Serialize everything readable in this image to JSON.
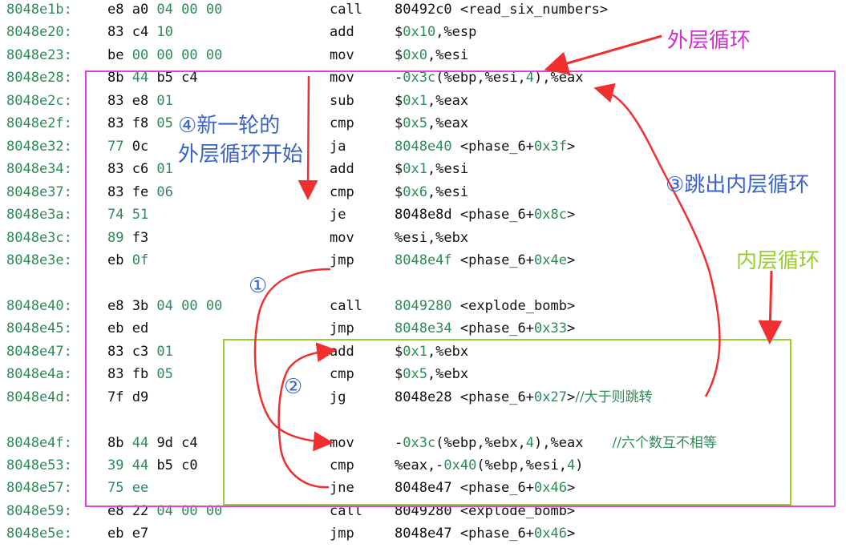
{
  "colors": {
    "addr": "#2e8b57",
    "text": "#111111",
    "numeric": "#2e8b57",
    "outer_box": "#e040e0",
    "inner_box": "#9acd32",
    "arrow": "#f03030",
    "annot_blue": "#3a63c8",
    "annot_magenta": "#d030d0",
    "annot_green": "#9acd32"
  },
  "rows": [
    {
      "addr": "8048e1b:",
      "bytes": [
        [
          "e8 a0 ",
          "h"
        ],
        [
          "04 00 00",
          "n"
        ]
      ],
      "mnem": "call",
      "ops": [
        [
          "80492c0 <read_six_numbers>",
          "t"
        ]
      ]
    },
    {
      "addr": "8048e20:",
      "bytes": [
        [
          "83 c4 ",
          "h"
        ],
        [
          "10",
          "n"
        ]
      ],
      "mnem": "add",
      "ops": [
        [
          "$",
          "t"
        ],
        [
          "0x10",
          "n"
        ],
        [
          ",%esp",
          "t"
        ]
      ]
    },
    {
      "addr": "8048e23:",
      "bytes": [
        [
          "be ",
          "h"
        ],
        [
          "00 00 00 00",
          "n"
        ]
      ],
      "mnem": "mov",
      "ops": [
        [
          "$",
          "t"
        ],
        [
          "0x0",
          "n"
        ],
        [
          ",%esi",
          "t"
        ]
      ]
    },
    {
      "addr": "8048e28:",
      "bytes": [
        [
          "8b ",
          "h"
        ],
        [
          "44 ",
          "n"
        ],
        [
          "b5 c4",
          "h"
        ]
      ],
      "mnem": "mov",
      "ops": [
        [
          "-",
          "t"
        ],
        [
          "0x3c",
          "n"
        ],
        [
          "(%ebp,%esi,",
          "t"
        ],
        [
          "4",
          "n"
        ],
        [
          "),%eax",
          "t"
        ]
      ]
    },
    {
      "addr": "8048e2c:",
      "bytes": [
        [
          "83 e8 ",
          "h"
        ],
        [
          "01",
          "n"
        ]
      ],
      "mnem": "sub",
      "ops": [
        [
          "$",
          "t"
        ],
        [
          "0x1",
          "n"
        ],
        [
          ",%eax",
          "t"
        ]
      ]
    },
    {
      "addr": "8048e2f:",
      "bytes": [
        [
          "83 f8 ",
          "h"
        ],
        [
          "05",
          "n"
        ]
      ],
      "mnem": "cmp",
      "ops": [
        [
          "$",
          "t"
        ],
        [
          "0x5",
          "n"
        ],
        [
          ",%eax",
          "t"
        ]
      ]
    },
    {
      "addr": "8048e32:",
      "bytes": [
        [
          "77 ",
          "n"
        ],
        [
          "0c",
          "h"
        ]
      ],
      "mnem": "ja",
      "ops": [
        [
          "8048e40",
          "n"
        ],
        [
          " <phase_6+",
          "t"
        ],
        [
          "0x3f",
          "n"
        ],
        [
          ">",
          "t"
        ]
      ]
    },
    {
      "addr": "8048e34:",
      "bytes": [
        [
          "83 c6 ",
          "h"
        ],
        [
          "01",
          "n"
        ]
      ],
      "mnem": "add",
      "ops": [
        [
          "$",
          "t"
        ],
        [
          "0x1",
          "n"
        ],
        [
          ",%esi",
          "t"
        ]
      ]
    },
    {
      "addr": "8048e37:",
      "bytes": [
        [
          "83 fe ",
          "h"
        ],
        [
          "06",
          "n"
        ]
      ],
      "mnem": "cmp",
      "ops": [
        [
          "$",
          "t"
        ],
        [
          "0x6",
          "n"
        ],
        [
          ",%esi",
          "t"
        ]
      ]
    },
    {
      "addr": "8048e3a:",
      "bytes": [
        [
          "74 51",
          "n"
        ]
      ],
      "mnem": "je",
      "ops": [
        [
          "8048e8d <phase_6+",
          "t"
        ],
        [
          "0x8c",
          "n"
        ],
        [
          ">",
          "t"
        ]
      ]
    },
    {
      "addr": "8048e3c:",
      "bytes": [
        [
          "89 ",
          "n"
        ],
        [
          "f3",
          "h"
        ]
      ],
      "mnem": "mov",
      "ops": [
        [
          "%esi,%ebx",
          "t"
        ]
      ]
    },
    {
      "addr": "8048e3e:",
      "bytes": [
        [
          "eb ",
          "h"
        ],
        [
          "0f",
          "n"
        ]
      ],
      "mnem": "jmp",
      "ops": [
        [
          "8048e4f",
          "n"
        ],
        [
          " <phase_6+",
          "t"
        ],
        [
          "0x4e",
          "n"
        ],
        [
          ">",
          "t"
        ]
      ]
    },
    null,
    {
      "addr": "8048e40:",
      "bytes": [
        [
          "e8 3b ",
          "h"
        ],
        [
          "04 00 00",
          "n"
        ]
      ],
      "mnem": "call",
      "ops": [
        [
          "8049280",
          "n"
        ],
        [
          " <explode_bomb>",
          "t"
        ]
      ]
    },
    {
      "addr": "8048e45:",
      "bytes": [
        [
          "eb ed",
          "h"
        ]
      ],
      "mnem": "jmp",
      "ops": [
        [
          "8048e34",
          "n"
        ],
        [
          " <phase_6+",
          "t"
        ],
        [
          "0x33",
          "n"
        ],
        [
          ">",
          "t"
        ]
      ]
    },
    {
      "addr": "8048e47:",
      "bytes": [
        [
          "83 c3 ",
          "h"
        ],
        [
          "01",
          "n"
        ]
      ],
      "mnem": "add",
      "ops": [
        [
          "$",
          "t"
        ],
        [
          "0x1",
          "n"
        ],
        [
          ",%ebx",
          "t"
        ]
      ]
    },
    {
      "addr": "8048e4a:",
      "bytes": [
        [
          "83 fb ",
          "h"
        ],
        [
          "05",
          "n"
        ]
      ],
      "mnem": "cmp",
      "ops": [
        [
          "$",
          "t"
        ],
        [
          "0x5",
          "n"
        ],
        [
          ",%ebx",
          "t"
        ]
      ]
    },
    {
      "addr": "8048e4d:",
      "bytes": [
        [
          "7f d9",
          "h"
        ]
      ],
      "mnem": "jg",
      "ops": [
        [
          "8048e28 <phase_6+",
          "t"
        ],
        [
          "0x27",
          "n"
        ],
        [
          ">",
          "t"
        ]
      ],
      "comment": "//大于则跳转"
    },
    null,
    {
      "addr": "8048e4f:",
      "bytes": [
        [
          "8b ",
          "h"
        ],
        [
          "44 ",
          "n"
        ],
        [
          "9d c4",
          "h"
        ]
      ],
      "mnem": "mov",
      "ops": [
        [
          "-",
          "t"
        ],
        [
          "0x3c",
          "n"
        ],
        [
          "(%ebp,%ebx,",
          "t"
        ],
        [
          "4",
          "n"
        ],
        [
          "),%eax",
          "t"
        ]
      ],
      "comment": "//六个数互不相等"
    },
    {
      "addr": "8048e53:",
      "bytes": [
        [
          "39 ",
          "n"
        ],
        [
          "44 ",
          "n"
        ],
        [
          "b5 c0",
          "h"
        ]
      ],
      "mnem": "cmp",
      "ops": [
        [
          "%eax,-",
          "t"
        ],
        [
          "0x40",
          "n"
        ],
        [
          "(%ebp,%esi,",
          "t"
        ],
        [
          "4",
          "n"
        ],
        [
          ")",
          "t"
        ]
      ]
    },
    {
      "addr": "8048e57:",
      "bytes": [
        [
          "75 ee",
          "n"
        ]
      ],
      "mnem": "jne",
      "ops": [
        [
          "8048e47 <phase_6+",
          "t"
        ],
        [
          "0x46",
          "n"
        ],
        [
          ">",
          "t"
        ]
      ]
    },
    {
      "addr": "8048e59:",
      "bytes": [
        [
          "e8 22 ",
          "h"
        ],
        [
          "04 00 00",
          "n"
        ]
      ],
      "mnem": "call",
      "ops": [
        [
          "8049280 <explode_bomb>",
          "t"
        ]
      ]
    },
    {
      "addr": "8048e5e:",
      "bytes": [
        [
          "eb e7",
          "h"
        ]
      ],
      "mnem": "jmp",
      "ops": [
        [
          "8048e47 <phase_6+",
          "t"
        ],
        [
          "0x46",
          "n"
        ],
        [
          ">",
          "t"
        ]
      ]
    }
  ],
  "annotations": {
    "outer_loop": "外层循环",
    "inner_loop": "内层循环",
    "new_round_1": "④新一轮的",
    "new_round_2": "外层循环开始",
    "exit_inner": "③跳出内层循环",
    "step1": "①",
    "step2": "②"
  }
}
